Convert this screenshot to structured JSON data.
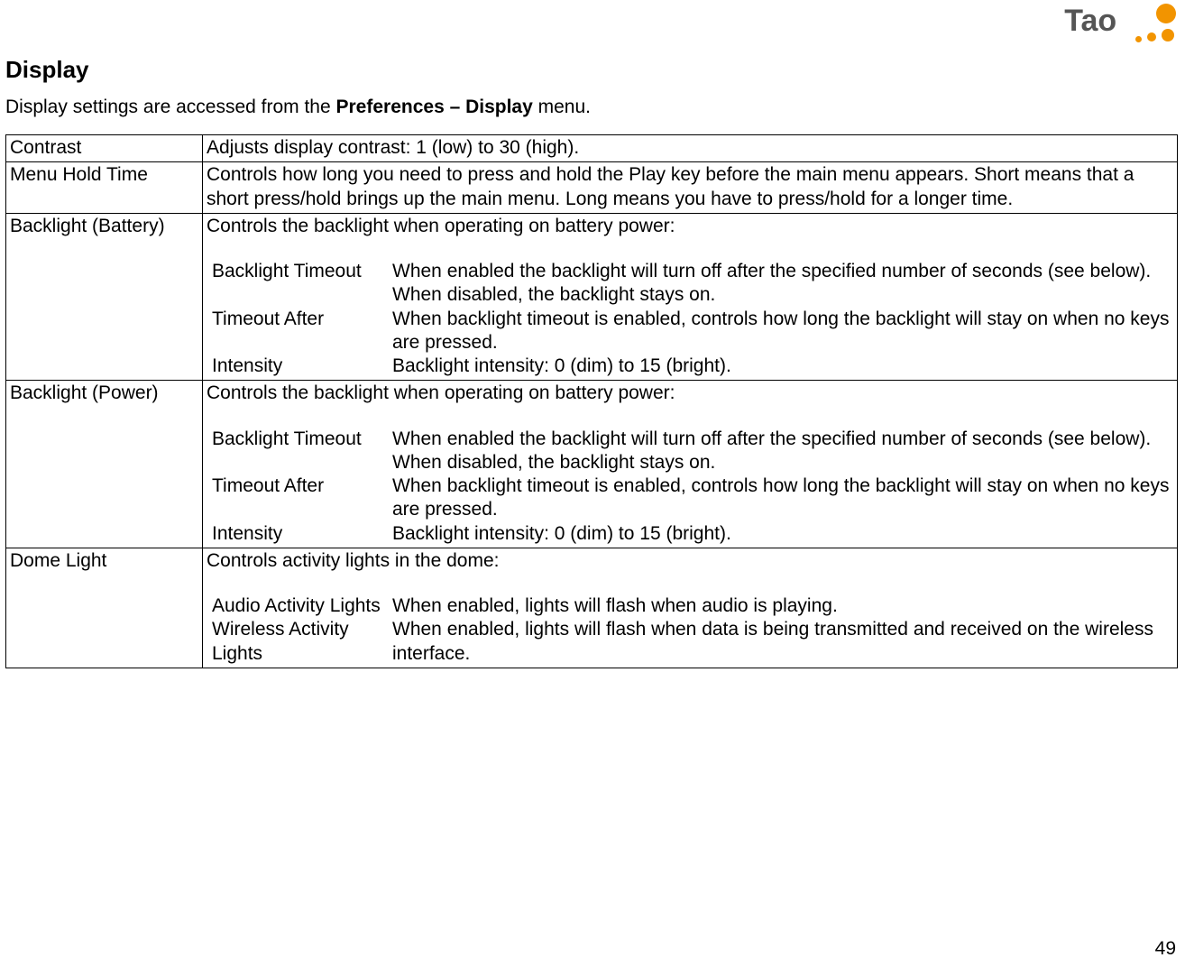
{
  "brand": "Tao",
  "page_number": "49",
  "section_title": "Display",
  "intro_prefix": "Display settings are accessed from the ",
  "intro_bold": "Preferences – Display",
  "intro_suffix": " menu.",
  "rows": {
    "contrast": {
      "label": "Contrast",
      "desc": "Adjusts display contrast: 1 (low) to 30 (high)."
    },
    "menu_hold": {
      "label": "Menu Hold Time",
      "desc": "Controls how long you need to press and hold the Play key before the main menu appears.  Short means that a short press/hold brings up the main menu.  Long means you have to press/hold for a longer time."
    },
    "backlight_battery": {
      "label": "Backlight (Battery)",
      "intro": "Controls the backlight when operating on battery power:",
      "rows": {
        "timeout": {
          "name": "Backlight Timeout",
          "desc": "When enabled the backlight will turn off after the specified number of seconds (see below).  When disabled, the backlight stays on."
        },
        "after": {
          "name": "Timeout After",
          "desc": "When backlight timeout is enabled, controls how long the backlight will stay on when no keys are pressed."
        },
        "intensity": {
          "name": "Intensity",
          "desc": "Backlight intensity: 0 (dim) to 15 (bright)."
        }
      }
    },
    "backlight_power": {
      "label": "Backlight (Power)",
      "intro": "Controls the backlight when operating on battery power:",
      "rows": {
        "timeout": {
          "name": "Backlight Timeout",
          "desc": "When enabled the backlight will turn off after the specified number of seconds (see below).  When disabled, the backlight stays on."
        },
        "after": {
          "name": "Timeout After",
          "desc": "When backlight timeout is enabled, controls how long the backlight will stay on when no keys are pressed."
        },
        "intensity": {
          "name": "Intensity",
          "desc": "Backlight intensity: 0 (dim) to 15 (bright)."
        }
      }
    },
    "dome": {
      "label": "Dome Light",
      "intro": "Controls activity lights in the dome:",
      "rows": {
        "audio": {
          "name": "Audio Activity Lights",
          "desc": "When enabled, lights will flash when audio is playing."
        },
        "wireless": {
          "name": "Wireless Activity Lights",
          "desc": "When enabled, lights will flash when data is being transmitted and received on the wireless interface."
        }
      }
    }
  }
}
